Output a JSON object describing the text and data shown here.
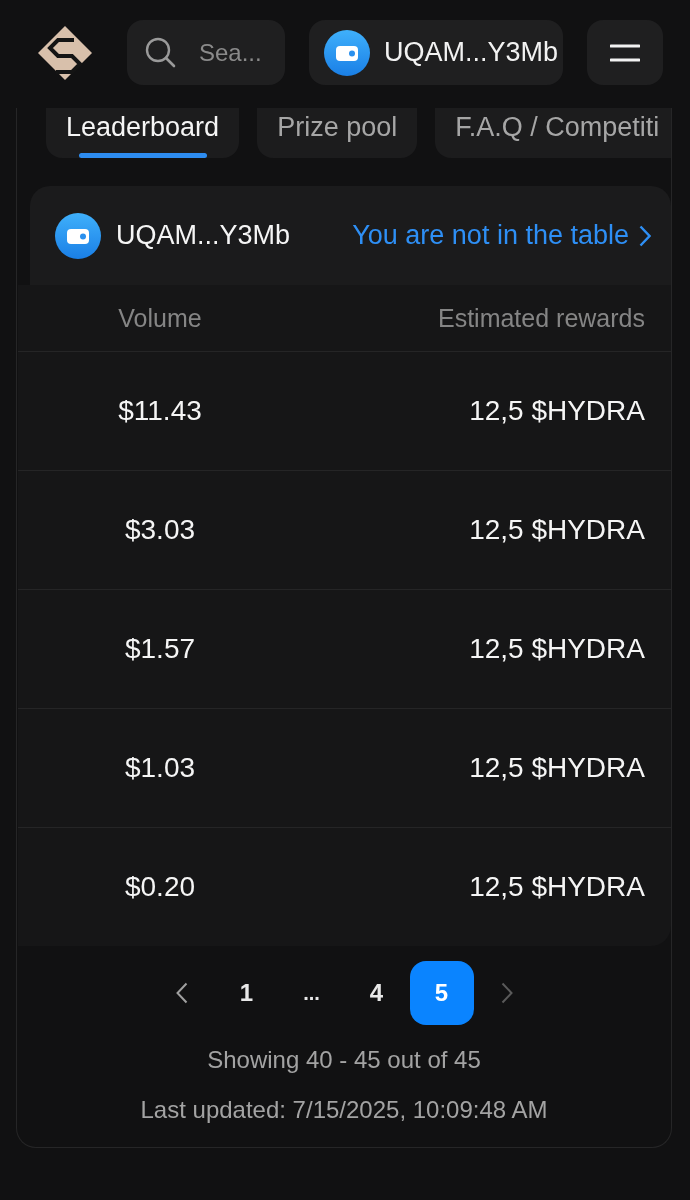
{
  "header": {
    "search": {
      "placeholder": "Sea..."
    },
    "wallet": {
      "address": "UQAM...Y3Mb"
    }
  },
  "tabs": [
    {
      "label": "Leaderboard",
      "selected": true
    },
    {
      "label": "Prize pool",
      "selected": false
    },
    {
      "label": "F.A.Q / Competiti",
      "selected": false
    }
  ],
  "user_row": {
    "address": "UQAM...Y3Mb",
    "status": "You are not in the table"
  },
  "table": {
    "columns": [
      "Volume",
      "Estimated rewards"
    ],
    "rows": [
      {
        "volume": "$11.43",
        "rewards": "12,5 $HYDRA"
      },
      {
        "volume": "$3.03",
        "rewards": "12,5 $HYDRA"
      },
      {
        "volume": "$1.57",
        "rewards": "12,5 $HYDRA"
      },
      {
        "volume": "$1.03",
        "rewards": "12,5 $HYDRA"
      },
      {
        "volume": "$0.20",
        "rewards": "12,5 $HYDRA"
      }
    ]
  },
  "pagination": {
    "previous": {
      "disabled": false
    },
    "items": [
      {
        "kind": "page",
        "label": "1",
        "selected": false
      },
      {
        "kind": "ellipsis",
        "label": "...",
        "selected": false
      },
      {
        "kind": "page",
        "label": "4",
        "selected": false
      },
      {
        "kind": "page",
        "label": "5",
        "selected": true
      }
    ],
    "next": {
      "disabled": true
    }
  },
  "summary": "Showing 40 - 45 out of 45",
  "last_updated": "Last updated: 7/15/2025, 10:09:48 AM"
}
